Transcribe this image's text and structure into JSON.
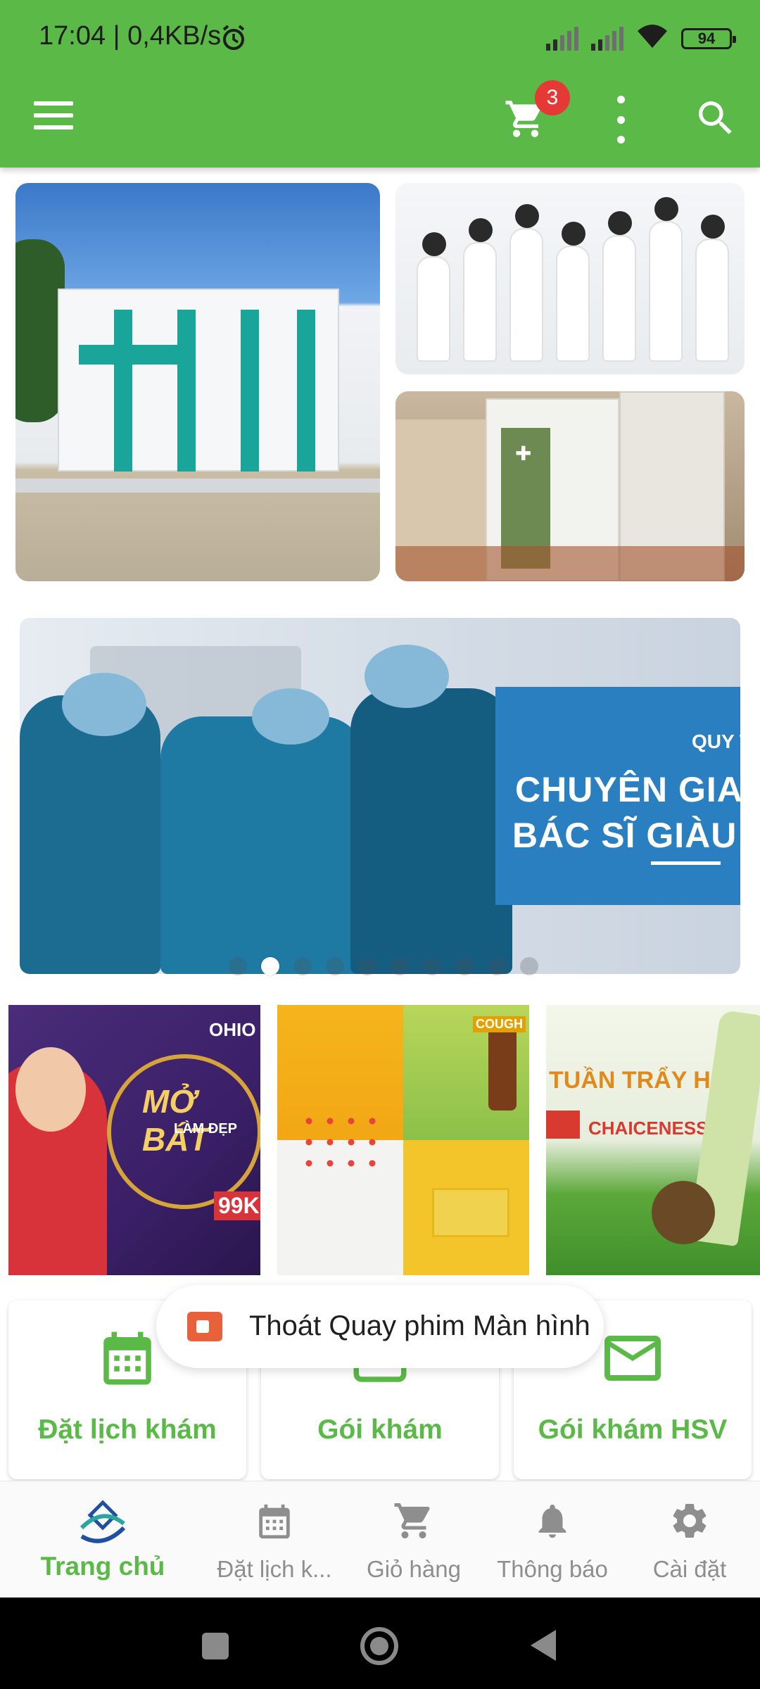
{
  "status_bar": {
    "time_speed": "17:04 | 0,4KB/s",
    "battery": "94"
  },
  "app_bar": {
    "cart_badge": "3",
    "icons": [
      "menu-icon",
      "cart-icon",
      "more-vert-icon",
      "search-icon"
    ]
  },
  "banner": {
    "tag": "QUY T",
    "line1": "CHUYÊN GIA",
    "line2": "BÁC SĨ GIÀU",
    "active_slide": 1,
    "total_slides": 10
  },
  "promos": {
    "p1_brand": "OHIO",
    "p1_headline": "MỞ BÁT",
    "p1_sub": "LÀM ĐẸP",
    "p1_price": "99K",
    "p2_brand": "COUGH",
    "p3_headline": "TUẦN TRẨY HỘI",
    "p3_brand": "CHAICENESS"
  },
  "quick_actions": [
    {
      "label": "Đặt lịch khám",
      "icon": "calendar-icon"
    },
    {
      "label": "Gói khám",
      "icon": "package-icon"
    },
    {
      "label": "Gói khám HSV",
      "icon": "mail-icon"
    }
  ],
  "toast": {
    "text": "Thoát Quay phim Màn hình",
    "icon": "screen-record-icon"
  },
  "bottom_nav": [
    {
      "label": "Trang chủ",
      "icon": "home-logo-icon",
      "active": true
    },
    {
      "label": "Đặt lịch k...",
      "icon": "calendar-icon",
      "active": false
    },
    {
      "label": "Giỏ hàng",
      "icon": "cart-icon",
      "active": false
    },
    {
      "label": "Thông báo",
      "icon": "bell-icon",
      "active": false
    },
    {
      "label": "Cài đặt",
      "icon": "gear-icon",
      "active": false
    }
  ],
  "colors": {
    "primary": "#5bb947",
    "badge": "#e53935",
    "banner_panel": "#2a7fc1",
    "inactive": "#8e8e8e"
  }
}
